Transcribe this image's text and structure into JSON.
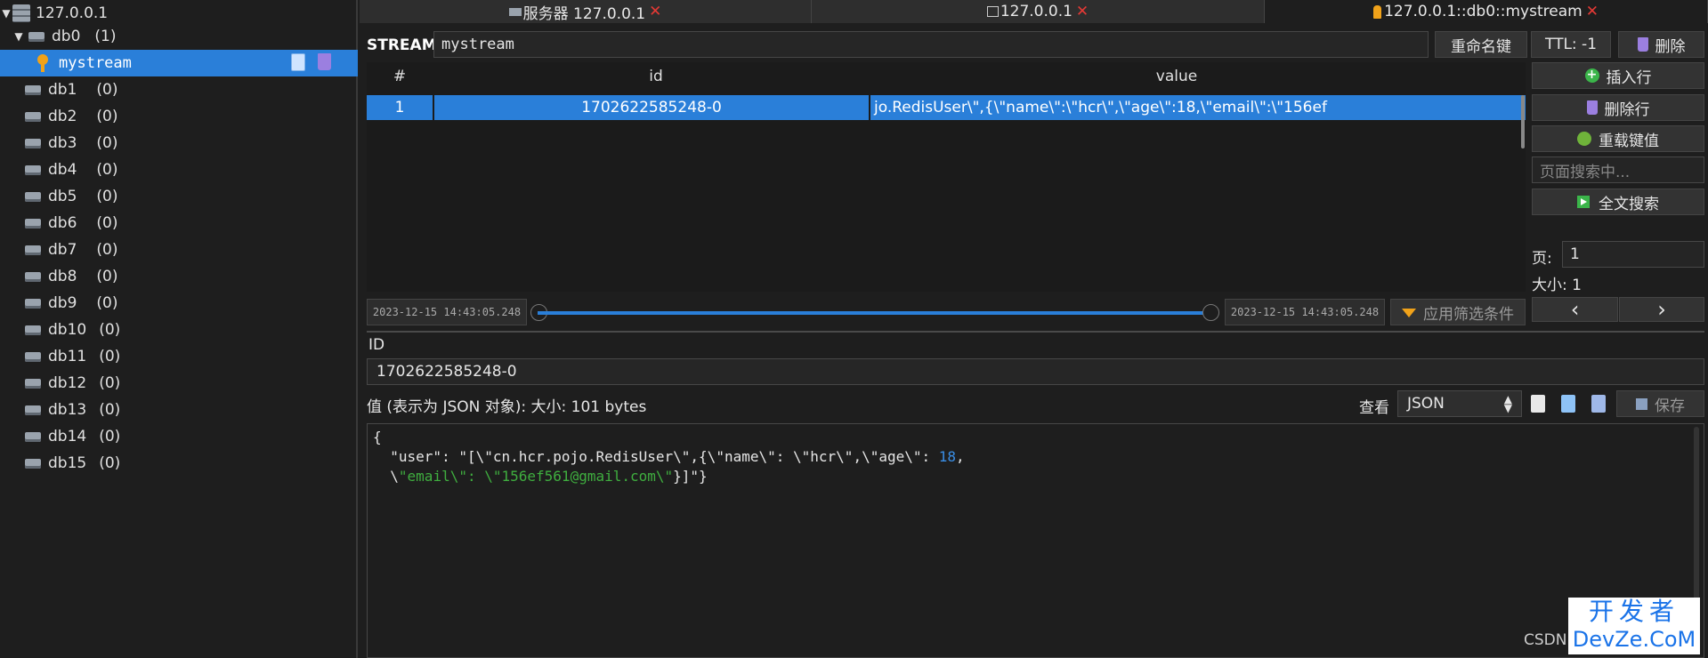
{
  "sidebar": {
    "server": "127.0.0.1",
    "db0": {
      "name": "db0",
      "count": "(1)"
    },
    "key": {
      "name": "mystream"
    },
    "dbs": [
      {
        "name": "db1",
        "count": "(0)"
      },
      {
        "name": "db2",
        "count": "(0)"
      },
      {
        "name": "db3",
        "count": "(0)"
      },
      {
        "name": "db4",
        "count": "(0)"
      },
      {
        "name": "db5",
        "count": "(0)"
      },
      {
        "name": "db6",
        "count": "(0)"
      },
      {
        "name": "db7",
        "count": "(0)"
      },
      {
        "name": "db8",
        "count": "(0)"
      },
      {
        "name": "db9",
        "count": "(0)"
      },
      {
        "name": "db10",
        "count": "(0)"
      },
      {
        "name": "db11",
        "count": "(0)"
      },
      {
        "name": "db12",
        "count": "(0)"
      },
      {
        "name": "db13",
        "count": "(0)"
      },
      {
        "name": "db14",
        "count": "(0)"
      },
      {
        "name": "db15",
        "count": "(0)"
      }
    ]
  },
  "tabs": [
    {
      "label": "服务器 127.0.0.1",
      "close": "✕"
    },
    {
      "label": "127.0.0.1",
      "close": "✕"
    },
    {
      "label": "127.0.0.1::db0::mystream",
      "close": "✕"
    }
  ],
  "header": {
    "stream_label": "STREAM:",
    "stream_value": "mystream",
    "rename_button": "重命名键",
    "ttl_button": "TTL: -1",
    "delete_button": "删除"
  },
  "table": {
    "columns": [
      "#",
      "id",
      "value"
    ],
    "rows": [
      {
        "num": "1",
        "id": "1702622585248-0",
        "value": "jo.RedisUser\\\",{\\\"name\\\":\\\"hcr\\\",\\\"age\\\":18,\\\"email\\\":\\\"156ef"
      }
    ]
  },
  "actions": {
    "insert_row": "插入行",
    "delete_row": "删除行",
    "reload_value": "重载键值",
    "page_search_placeholder": "页面搜索中...",
    "full_search": "全文搜索",
    "page_label": "页:",
    "page_value": "1",
    "size_label": "大小: 1",
    "prev": "‹",
    "next": "›"
  },
  "slider": {
    "start": "2023-12-15 14:43:05.248",
    "end": "2023-12-15 14:43:05.248",
    "apply_filter": "应用筛选条件"
  },
  "detail": {
    "id_label": "ID",
    "id_value": "1702622585248-0",
    "value_label": "值 (表示为 JSON 对象): 大小: 101 bytes",
    "view_label": "查看",
    "view_value": "JSON",
    "save_button": "保存"
  },
  "editor": {
    "line1": "{",
    "line2_key": "  \"user\": \"[\\\"cn.hcr.pojo.RedisUser\\\",{\\\"name\\\": \\\"hcr\\\",\\\"age\\\": ",
    "line2_num": "18",
    "line2_end": ",",
    "line3_pre": "  \\",
    "line3_green": "\"email\\\": \\\"156ef561@gmail.com\\\"",
    "line3_end": "}]\"}"
  },
  "watermark": {
    "csdn": "CSDN",
    "logo_line1": "开发者",
    "logo_line2": "DevZe.CoM"
  },
  "colors": {
    "selection": "#2a7fd9",
    "key_icon": "#f0a21a",
    "close_x": "#e53935",
    "json_string": "#3fae3f",
    "json_number": "#3a8ee6"
  }
}
